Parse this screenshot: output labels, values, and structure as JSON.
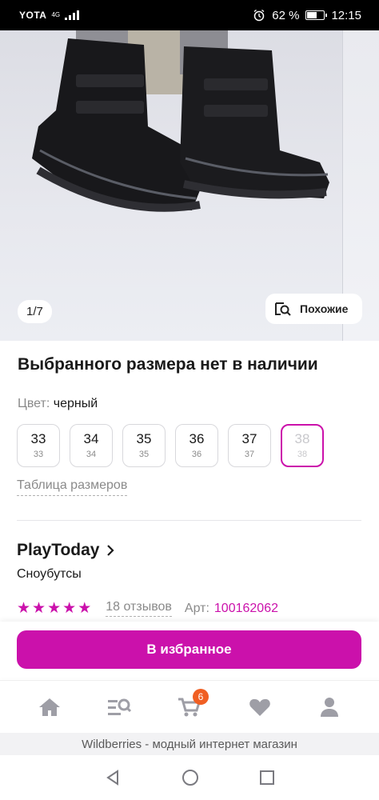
{
  "status_bar": {
    "carrier": "YOTA",
    "network": "4G",
    "battery_percent": "62 %",
    "battery_level": 0.62,
    "time": "12:15"
  },
  "gallery": {
    "counter": "1/7",
    "similar_label": "Похожие"
  },
  "product": {
    "availability_notice": "Выбранного размера нет в наличии",
    "color_label": "Цвет:",
    "color_value": "черный",
    "sizes": [
      {
        "main": "33",
        "sub": "33",
        "selected": false
      },
      {
        "main": "34",
        "sub": "34",
        "selected": false
      },
      {
        "main": "35",
        "sub": "35",
        "selected": false
      },
      {
        "main": "36",
        "sub": "36",
        "selected": false
      },
      {
        "main": "37",
        "sub": "37",
        "selected": false
      },
      {
        "main": "38",
        "sub": "38",
        "selected": true
      }
    ],
    "size_table_link": "Таблица размеров",
    "brand": "PlayToday",
    "name": "Сноубутсы",
    "rating_stars": 5,
    "reviews": "18 отзывов",
    "article_label": "Арт:",
    "article_value": "100162062"
  },
  "actions": {
    "favorite_button": "В избранное"
  },
  "tabbar": {
    "cart_badge": "6",
    "icons": [
      "home-icon",
      "catalog-search-icon",
      "cart-icon",
      "heart-icon",
      "profile-icon"
    ]
  },
  "footer": {
    "text": "Wildberries - модный интернет магазин"
  },
  "colors": {
    "accent": "#cb11ab",
    "badge": "#f05f23"
  }
}
